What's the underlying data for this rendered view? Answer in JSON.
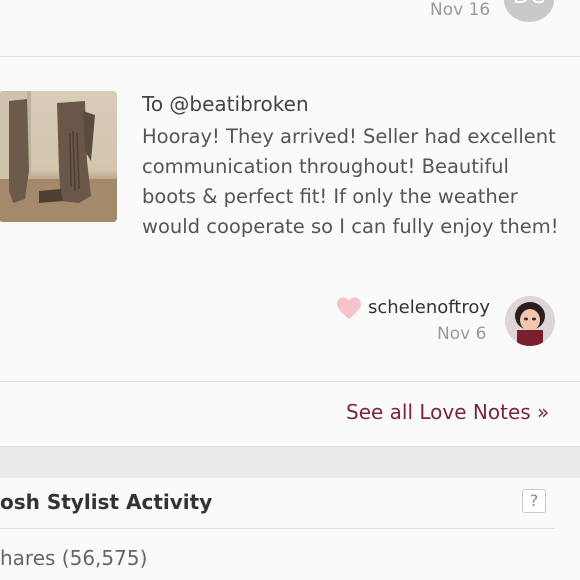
{
  "prev_note": {
    "date": "Nov 16",
    "avatar_initials": "DC"
  },
  "love_note": {
    "to": "To @beatibroken",
    "text": "Hooray! They arrived! Seller had excellent communication throughout! Beautiful boots & perfect fit! If only the weather would cooperate so I can fully enjoy them!",
    "username": "schelenoftroy",
    "date": "Nov 6",
    "heart_color": "#f6c2cc"
  },
  "see_all_label": "See all Love Notes »",
  "stylist": {
    "title": "osh Stylist Activity",
    "help_label": "?",
    "shares": "hares (56,575)"
  }
}
